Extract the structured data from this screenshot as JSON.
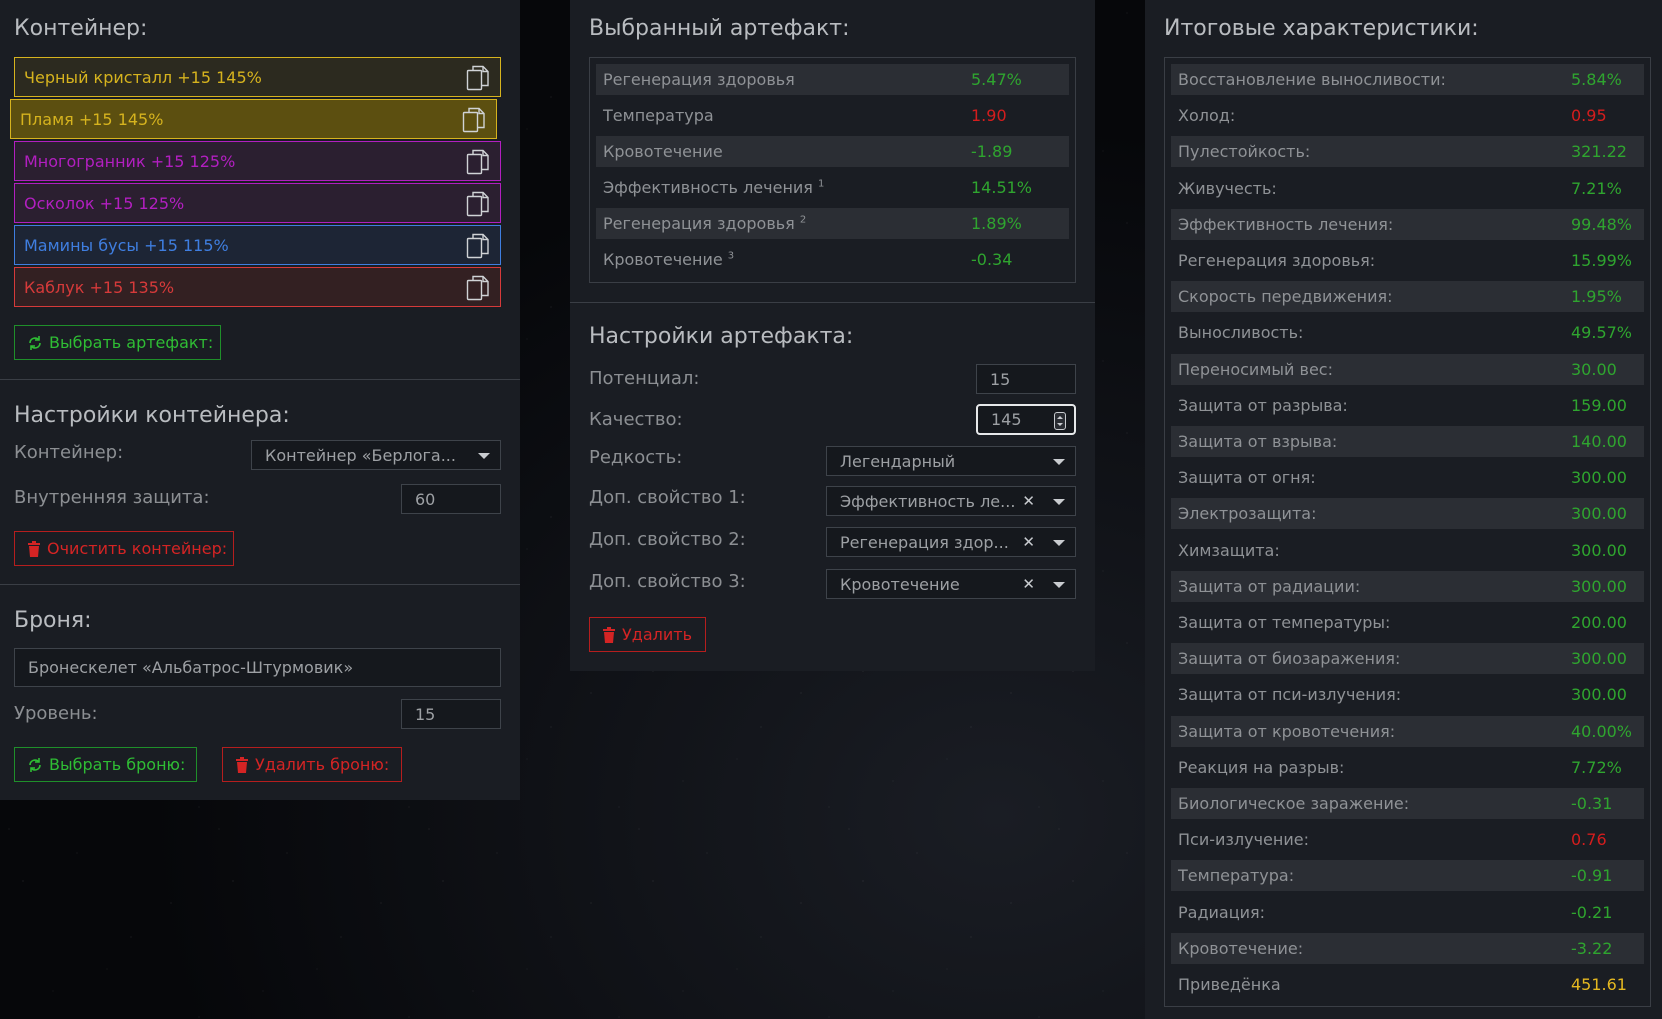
{
  "container_section": {
    "title": "Контейнер:",
    "artifacts": [
      {
        "label": "Черный кристалл +15 145%",
        "color": "#d6b31e",
        "bg": "#2c2a1f"
      },
      {
        "label": "Пламя +15 145%",
        "color": "#d6b31e",
        "bg": "#5c4f10"
      },
      {
        "label": "Многогранник +15 125%",
        "color": "#b21fc0",
        "bg": "#2b1f30"
      },
      {
        "label": "Осколок +15 125%",
        "color": "#b21fc0",
        "bg": "#2b1f30"
      },
      {
        "label": "Мамины бусы +15 115%",
        "color": "#3f7ee0",
        "bg": "#1d2535"
      },
      {
        "label": "Каблук +15 135%",
        "color": "#d63a3a",
        "bg": "#332022"
      }
    ],
    "select_artifact_button": "Выбрать артефакт:"
  },
  "container_settings": {
    "title": "Настройки контейнера:",
    "container_label": "Контейнер:",
    "container_value": "Контейнер «Берлога...",
    "inner_protection_label": "Внутренняя защита:",
    "inner_protection_value": "60",
    "clear_button": "Очистить контейнер:"
  },
  "armor": {
    "title": "Броня:",
    "armor_value": "Бронескелет «Альбатрос-Штурмовик»",
    "level_label": "Уровень:",
    "level_value": "15",
    "select_button": "Выбрать броню:",
    "delete_button": "Удалить броню:"
  },
  "selected_artifact": {
    "title": "Выбранный артефакт:",
    "stats": [
      {
        "name": "Регенерация здоровья",
        "sup": "",
        "value": "5.47%",
        "tone": "green"
      },
      {
        "name": "Температура",
        "sup": "",
        "value": "1.90",
        "tone": "red"
      },
      {
        "name": "Кровотечение",
        "sup": "",
        "value": "-1.89",
        "tone": "green"
      },
      {
        "name": "Эффективность лечения",
        "sup": "1",
        "value": "14.51%",
        "tone": "green"
      },
      {
        "name": "Регенерация здоровья",
        "sup": "2",
        "value": "1.89%",
        "tone": "green"
      },
      {
        "name": "Кровотечение",
        "sup": "3",
        "value": "-0.34",
        "tone": "green"
      }
    ]
  },
  "artifact_settings": {
    "title": "Настройки артефакта:",
    "potential_label": "Потенциал:",
    "potential_value": "15",
    "quality_label": "Качество:",
    "quality_value": "145",
    "rarity_label": "Редкость:",
    "rarity_value": "Легендарный",
    "prop1_label": "Доп. свойство 1:",
    "prop1_value": "Эффективность ле...",
    "prop2_label": "Доп. свойство 2:",
    "prop2_value": "Регенерация здор...",
    "prop3_label": "Доп. свойство 3:",
    "prop3_value": "Кровотечение",
    "delete_button": "Удалить"
  },
  "totals": {
    "title": "Итоговые характеристики:",
    "stats": [
      {
        "name": "Восстановление выносливости:",
        "value": "5.84%",
        "tone": "green"
      },
      {
        "name": "Холод:",
        "value": "0.95",
        "tone": "red"
      },
      {
        "name": "Пулестойкость:",
        "value": "321.22",
        "tone": "green"
      },
      {
        "name": "Живучесть:",
        "value": "7.21%",
        "tone": "green"
      },
      {
        "name": "Эффективность лечения:",
        "value": "99.48%",
        "tone": "green"
      },
      {
        "name": "Регенерация здоровья:",
        "value": "15.99%",
        "tone": "green"
      },
      {
        "name": "Скорость передвижения:",
        "value": "1.95%",
        "tone": "green"
      },
      {
        "name": "Выносливость:",
        "value": "49.57%",
        "tone": "green"
      },
      {
        "name": "Переносимый вес:",
        "value": "30.00",
        "tone": "green"
      },
      {
        "name": "Защита от разрыва:",
        "value": "159.00",
        "tone": "green"
      },
      {
        "name": "Защита от взрыва:",
        "value": "140.00",
        "tone": "green"
      },
      {
        "name": "Защита от огня:",
        "value": "300.00",
        "tone": "green"
      },
      {
        "name": "Электрозащита:",
        "value": "300.00",
        "tone": "green"
      },
      {
        "name": "Химзащита:",
        "value": "300.00",
        "tone": "green"
      },
      {
        "name": "Защита от радиации:",
        "value": "300.00",
        "tone": "green"
      },
      {
        "name": "Защита от температуры:",
        "value": "200.00",
        "tone": "green"
      },
      {
        "name": "Защита от биозаражения:",
        "value": "300.00",
        "tone": "green"
      },
      {
        "name": "Защита от пси-излучения:",
        "value": "300.00",
        "tone": "green"
      },
      {
        "name": "Защита от кровотечения:",
        "value": "40.00%",
        "tone": "green"
      },
      {
        "name": "Реакция на разрыв:",
        "value": "7.72%",
        "tone": "green"
      },
      {
        "name": "Биологическое заражение:",
        "value": "-0.31",
        "tone": "green"
      },
      {
        "name": "Пси-излучение:",
        "value": "0.76",
        "tone": "red"
      },
      {
        "name": "Температура:",
        "value": "-0.91",
        "tone": "green"
      },
      {
        "name": "Радиация:",
        "value": "-0.21",
        "tone": "green"
      },
      {
        "name": "Кровотечение:",
        "value": "-3.22",
        "tone": "green"
      },
      {
        "name": "Приведёнка",
        "value": "451.61",
        "tone": "yellow"
      }
    ]
  },
  "colors": {
    "green": "#2fa52f",
    "red": "#d41d1d",
    "yellow": "#e5b820",
    "panel": "#1a1d23"
  }
}
